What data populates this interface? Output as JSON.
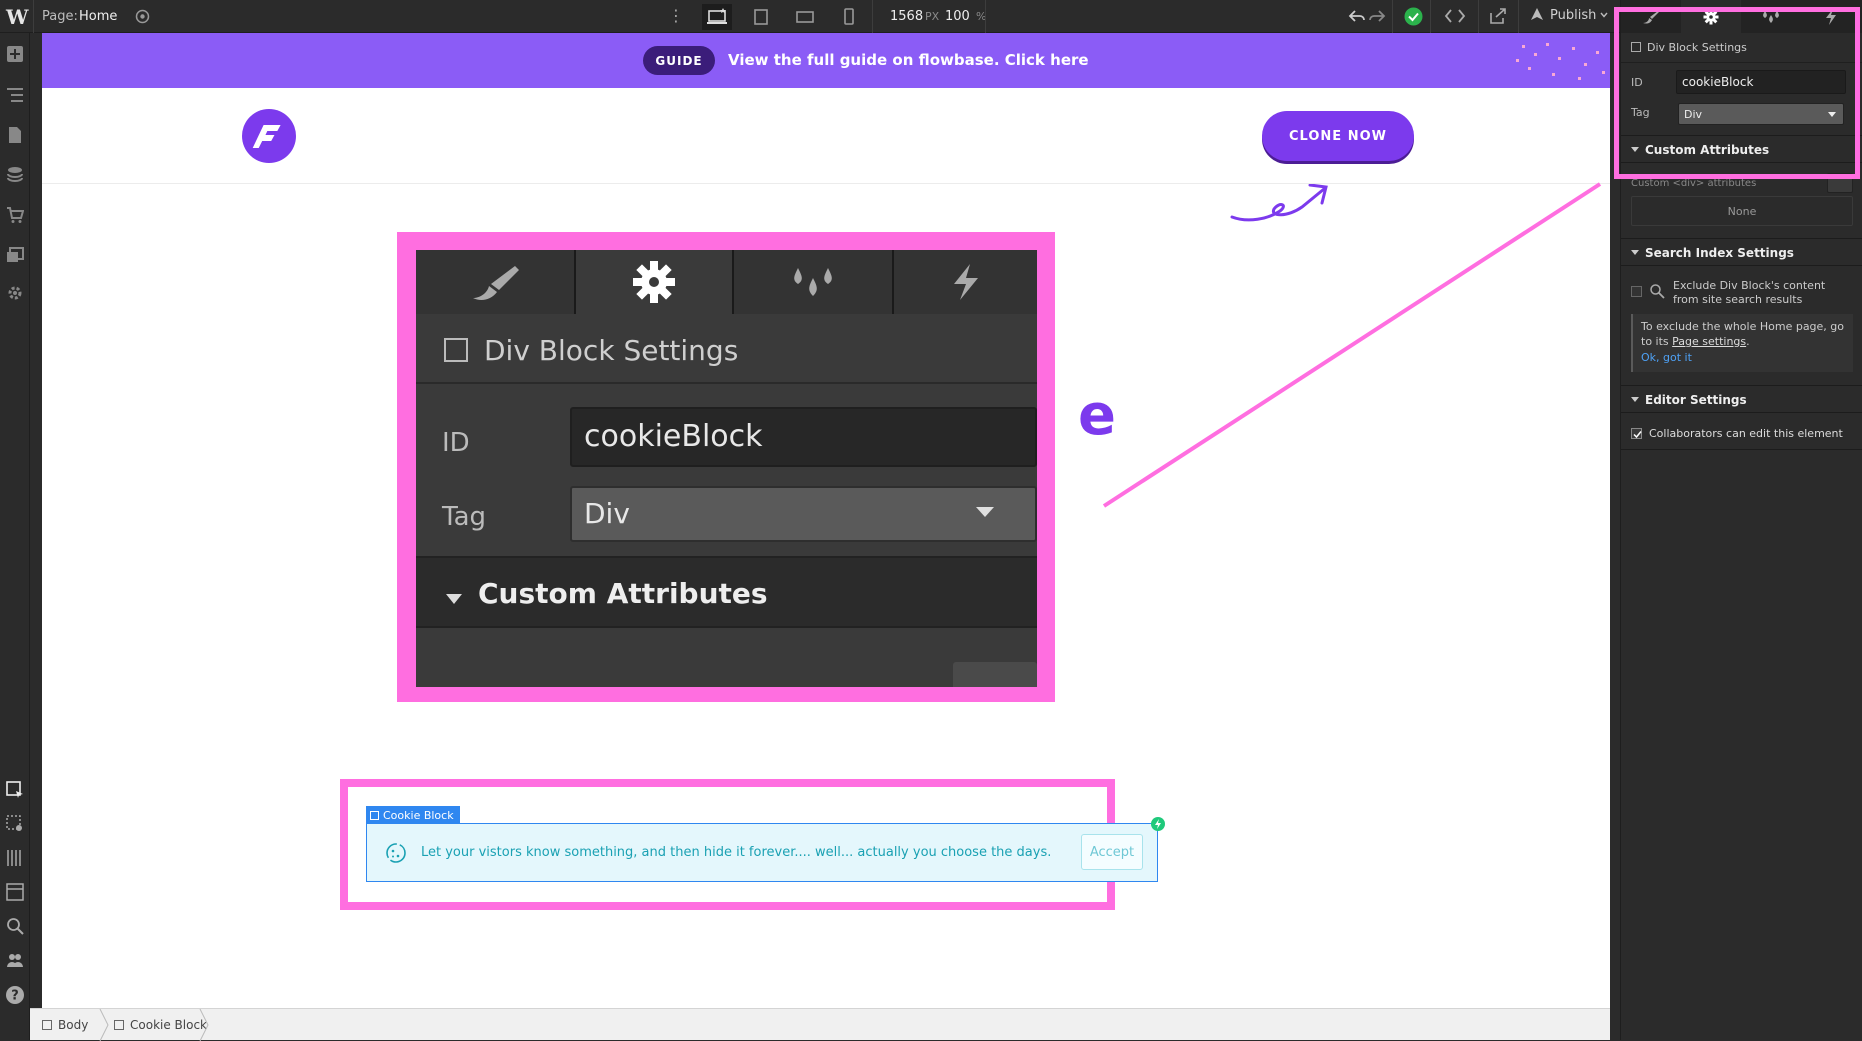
{
  "topbar": {
    "page_label": "Page:",
    "page_name": "Home",
    "canvas_width": "1568",
    "canvas_width_unit": "PX",
    "zoom": "100",
    "zoom_unit": "%",
    "publish_label": "Publish"
  },
  "banner": {
    "pill": "GUIDE",
    "text": "View the full guide on flowbase. Click here"
  },
  "site": {
    "clone_button": "CLONE NOW",
    "heading_fragment": "e"
  },
  "zoom_inset": {
    "settings_title": "Div Block Settings",
    "id_label": "ID",
    "id_value": "cookieBlock",
    "tag_label": "Tag",
    "tag_value": "Div",
    "custom_attributes": "Custom Attributes"
  },
  "cookie": {
    "tag_label": "Cookie Block",
    "message": "Let your vistors know something, and then hide it forever.... well... actually you choose the days.",
    "accept": "Accept"
  },
  "breadcrumb": [
    "Body",
    "Cookie Block"
  ],
  "panel": {
    "settings_title": "Div Block Settings",
    "id_label": "ID",
    "id_value": "cookieBlock",
    "tag_label": "Tag",
    "tag_value": "Div",
    "custom_attributes": "Custom Attributes",
    "custom_div_attributes": "Custom <div> attributes",
    "none_label": "None",
    "search_index": "Search Index Settings",
    "exclude_text": "Exclude Div Block's content from site search results",
    "notice_text_1": "To exclude the whole Home page, go to its ",
    "notice_link": "Page settings",
    "notice_text_2": ".",
    "ok_got_it": "Ok, got it",
    "editor_settings": "Editor Settings",
    "collaborators": "Collaborators can edit this element"
  },
  "colors": {
    "brand_purple": "#7c3aed",
    "banner_purple": "#8b5cf6",
    "highlight_pink": "#ff6ee0",
    "selection_blue": "#2f87f0",
    "cookie_teal": "#1aa1b3"
  },
  "icons": [
    "webflow-logo-icon",
    "add-icon",
    "navigator-icon",
    "pages-icon",
    "cms-icon",
    "ecommerce-icon",
    "assets-icon",
    "settings-icon",
    "select-icon",
    "preview-icon",
    "grid-icon",
    "style-manager-icon",
    "search-icon",
    "users-icon",
    "help-icon",
    "eye-icon",
    "desktop-icon",
    "tablet-icon",
    "mobile-landscape-icon",
    "mobile-portrait-icon",
    "undo-icon",
    "redo-icon",
    "check-icon",
    "code-icon",
    "export-icon",
    "brush-icon",
    "gear-icon",
    "drops-icon",
    "bolt-icon",
    "cookie-icon"
  ]
}
